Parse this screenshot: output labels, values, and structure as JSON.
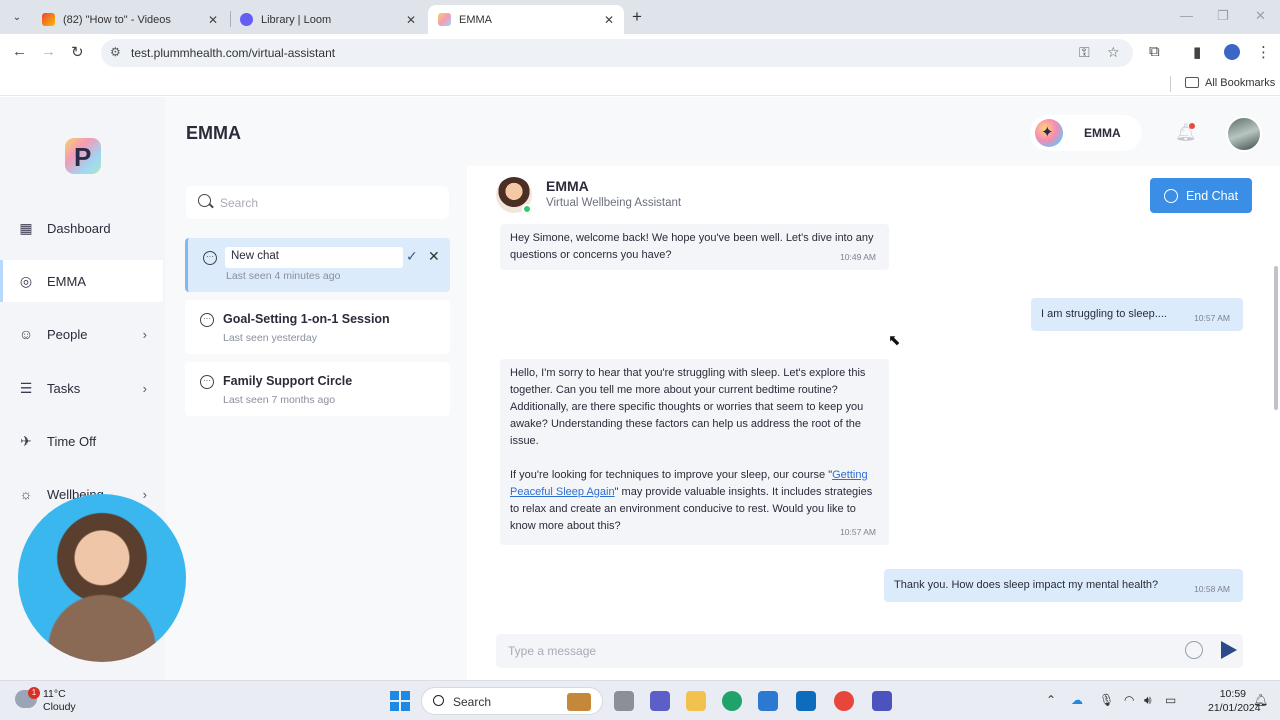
{
  "browser": {
    "tabs": [
      {
        "title": "(82) \"How to\" - Videos",
        "active": false
      },
      {
        "title": "Library | Loom",
        "active": false
      },
      {
        "title": "EMMA",
        "active": true
      }
    ],
    "url": "test.plummhealth.com/virtual-assistant",
    "bookmarks_label": "All Bookmarks"
  },
  "sidebar": {
    "logo_letter": "P",
    "items": [
      {
        "label": "Dashboard",
        "icon": "grid-icon",
        "has_children": false
      },
      {
        "label": "EMMA",
        "icon": "chat-icon",
        "has_children": false,
        "active": true
      },
      {
        "label": "People",
        "icon": "people-icon",
        "has_children": true
      },
      {
        "label": "Tasks",
        "icon": "tasks-icon",
        "has_children": true
      },
      {
        "label": "Time Off",
        "icon": "plane-icon",
        "has_children": false
      },
      {
        "label": "Wellbeing",
        "icon": "sun-icon",
        "has_children": true
      }
    ]
  },
  "header": {
    "title": "EMMA",
    "assistant_name": "EMMA"
  },
  "chat_list": {
    "search_placeholder": "Search",
    "items": [
      {
        "title": "New chat",
        "subtitle": "Last seen 4 minutes ago",
        "editing": true
      },
      {
        "title": "Goal-Setting 1-on-1 Session",
        "subtitle": "Last seen yesterday"
      },
      {
        "title": "Family Support Circle",
        "subtitle": "Last seen 7 months ago"
      }
    ]
  },
  "chat": {
    "bot_name": "EMMA",
    "bot_role": "Virtual Wellbeing Assistant",
    "end_chat_label": "End Chat",
    "messages": [
      {
        "from": "bot",
        "text": "Hey Simone, welcome back! We hope you've been well. Let's dive into any questions or concerns you have?",
        "time": "10:49 AM"
      },
      {
        "from": "user",
        "text": "I am struggling to sleep....",
        "time": "10:57 AM"
      },
      {
        "from": "bot",
        "p1": "Hello, I'm sorry to hear that you're struggling with sleep. Let's explore this together. Can you tell me more about your current bedtime routine? Additionally, are there specific thoughts or worries that seem to keep you awake? Understanding these factors can help us address the root of the issue.",
        "p2_before": "If you're looking for techniques to improve your sleep, our course \"",
        "p2_link": "Getting Peaceful Sleep Again",
        "p2_after": "\" may provide valuable insights. It includes strategies to relax and create an environment conducive to rest. Would you like to know more about this?",
        "time": "10:57 AM"
      },
      {
        "from": "user",
        "text": "Thank you. How does sleep impact my mental health?",
        "time": "10:58 AM"
      }
    ],
    "composer_placeholder": "Type a message"
  },
  "taskbar": {
    "weather_temp": "11°C",
    "weather_cond": "Cloudy",
    "weather_badge": "1",
    "search_label": "Search",
    "time": "10:59",
    "date": "21/01/2024"
  }
}
